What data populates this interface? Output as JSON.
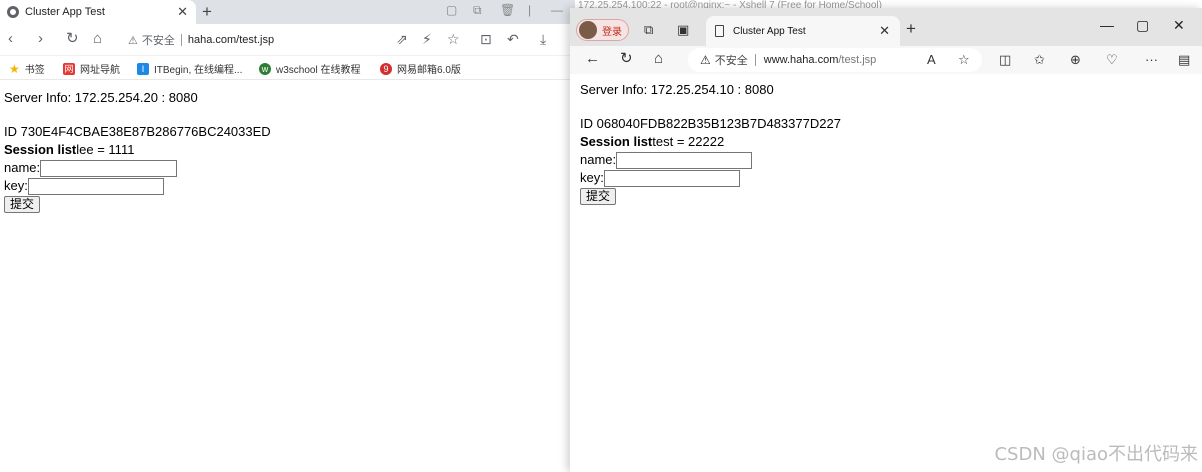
{
  "left": {
    "tab_title": "Cluster App Test",
    "url": "haha.com/test.jsp",
    "insecure_label": "不安全",
    "bookmarks": [
      "书签",
      "网址导航",
      "ITBegin, 在线编程...",
      "w3school 在线教程",
      "网易邮箱6.0版"
    ],
    "page": {
      "server_info": "Server Info: 172.25.254.20 : 8080",
      "session_id": "ID 730E4F4CBAE38E87B286776BC24033ED",
      "session_list_label": "Session list",
      "session_list_value": "lee = 1111",
      "name_label": "name:",
      "key_label": "key:",
      "submit_label": "提交"
    }
  },
  "right": {
    "background_title": "172.25.254.100:22 - root@nginx:~ - Xshell 7 (Free for Home/School)",
    "login_label": "登录",
    "tab_title": "Cluster App Test",
    "url_prefix": "www.haha.com",
    "url_path": "/test.jsp",
    "insecure_label": "不安全",
    "page": {
      "server_info": "Server Info: 172.25.254.10 : 8080",
      "session_id": "ID 068040FDB822B35B123B7D483377D227",
      "session_list_label": "Session list",
      "session_list_value": "test = 22222",
      "name_label": "name:",
      "key_label": "key:",
      "submit_label": "提交"
    }
  },
  "watermark": "CSDN @qiao不出代码来",
  "icons": {
    "back": "arrow-left-icon",
    "forward": "arrow-right-icon",
    "reload": "reload-icon",
    "home": "home-icon",
    "star": "star-icon",
    "close": "close-icon"
  }
}
